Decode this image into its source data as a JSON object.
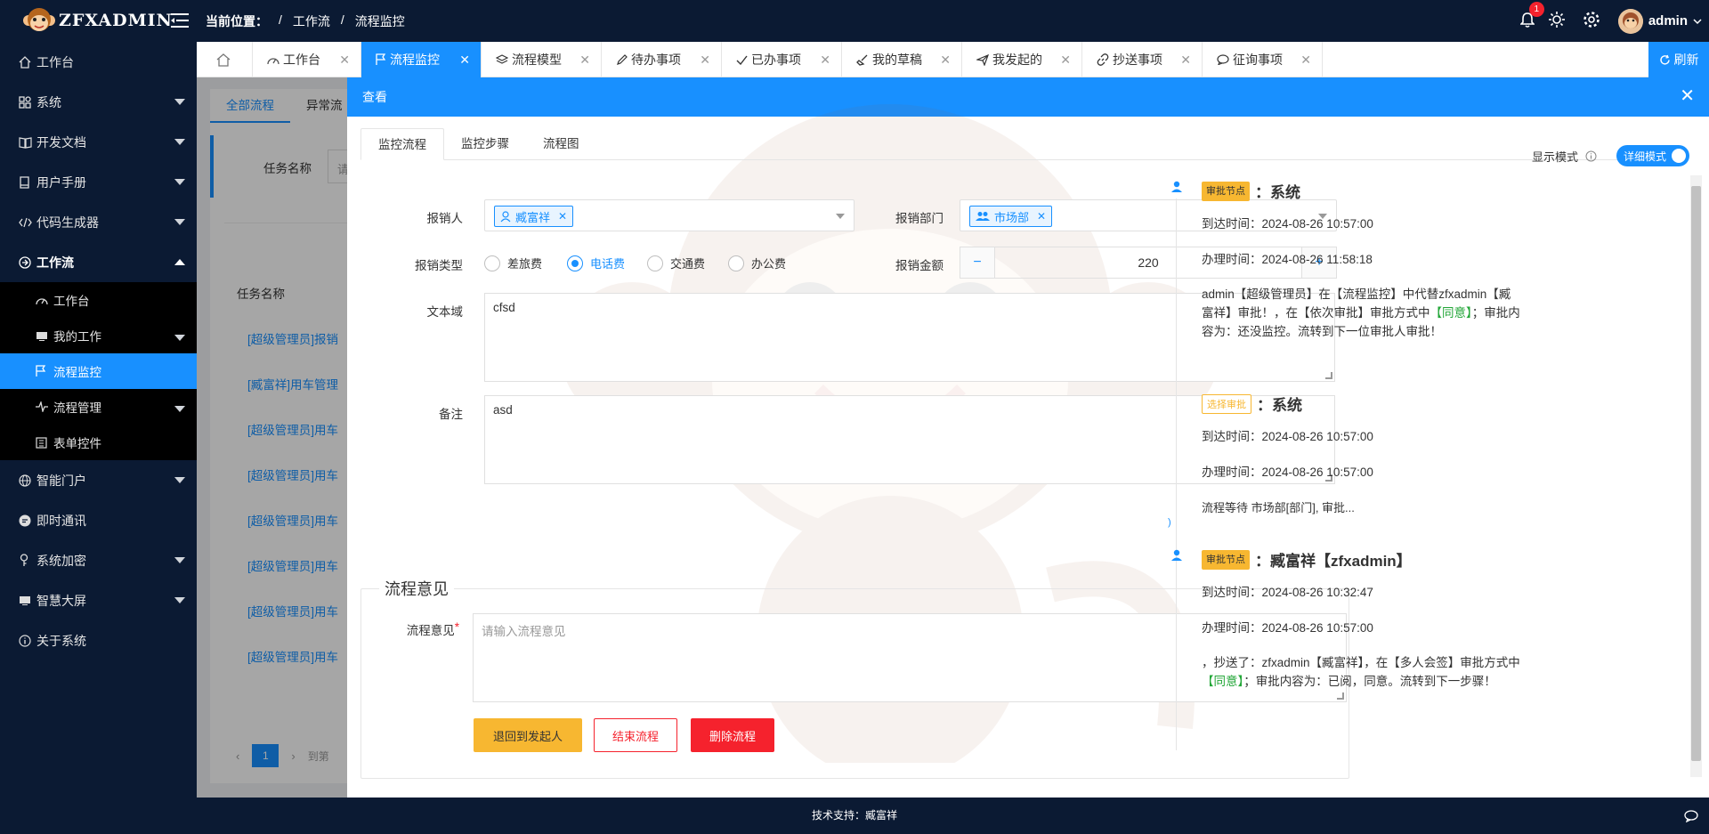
{
  "app": {
    "logo_text": "ZFXADMIN",
    "brand_color": "#1890ff",
    "dark_color": "#0b1a33"
  },
  "header": {
    "crumb_label": "当前位置：",
    "crumb_sep": "/",
    "crumb": [
      "工作流",
      "流程监控"
    ],
    "notification_count": "1",
    "user": "admin"
  },
  "sidebar": {
    "items": [
      {
        "label": "工作台",
        "icon": "home-icon"
      },
      {
        "label": "系统",
        "icon": "apps-icon"
      },
      {
        "label": "开发文档",
        "icon": "book-icon"
      },
      {
        "label": "用户手册",
        "icon": "manual-icon"
      },
      {
        "label": "代码生成器",
        "icon": "code-icon"
      },
      {
        "label": "工作流",
        "icon": "workflow-icon"
      }
    ],
    "sub_items": [
      {
        "label": "工作台"
      },
      {
        "label": "我的工作"
      },
      {
        "label": "流程监控"
      },
      {
        "label": "流程管理"
      },
      {
        "label": "表单控件"
      }
    ],
    "items_after": [
      {
        "label": "智能门户"
      },
      {
        "label": "即时通讯"
      },
      {
        "label": "系统加密"
      },
      {
        "label": "智慧大屏"
      },
      {
        "label": "关于系统"
      }
    ]
  },
  "tabs": [
    {
      "label": "工作台"
    },
    {
      "label": "流程监控"
    },
    {
      "label": "流程模型"
    },
    {
      "label": "待办事项"
    },
    {
      "label": "已办事项"
    },
    {
      "label": "我的草稿"
    },
    {
      "label": "我发起的"
    },
    {
      "label": "抄送事项"
    },
    {
      "label": "征询事项"
    }
  ],
  "refresh_label": "刷新",
  "background": {
    "tabs": [
      "全部流程",
      "异常流"
    ],
    "filter_label": "任务名称",
    "filter_placeholder": "请",
    "col_header": "任务名称",
    "rows": [
      "[超级管理员]报销",
      "[臧富祥]用车管理",
      "[超级管理员]用车",
      "[超级管理员]用车",
      "[超级管理员]用车",
      "[超级管理员]用车",
      "[超级管理员]用车",
      "[超级管理员]用车"
    ],
    "page": "1",
    "goto": "到第"
  },
  "modal": {
    "title": "查看",
    "tabs": [
      "监控流程",
      "监控步骤",
      "流程图"
    ],
    "form": {
      "applicant_label": "报销人",
      "applicant_value": "臧富祥",
      "dept_label": "报销部门",
      "dept_value": "市场部",
      "type_label": "报销类型",
      "type_options": [
        "差旅费",
        "电话费",
        "交通费",
        "办公费"
      ],
      "type_selected": "电话费",
      "amount_label": "报销金额",
      "amount_value": "220",
      "amount_minus": "−",
      "amount_plus": "+",
      "textarea_label": "文本域",
      "textarea_value": "cfsd",
      "remark_label": "备注",
      "remark_value": "asd"
    },
    "opinion": {
      "legend": "流程意见",
      "label": "流程意见",
      "required": "*",
      "placeholder": "请输入流程意见",
      "buttons": {
        "back": "退回到发起人",
        "end": "结束流程",
        "delete": "删除流程"
      }
    },
    "display_mode_label": "显示模式",
    "display_mode_value": "详细模式",
    "timeline": [
      {
        "tag": "审批节点",
        "title": "：系统",
        "arrive": "到达时间：2024-08-26 10:57:00",
        "handle": "办理时间：2024-08-26 11:58:18",
        "desc": "admin【超级管理员】在【流程监控】中代替zfxadmin【臧富祥】审批！，在【依次审批】审批方式中",
        "agree": "【同意】",
        "desc2": "；审批内容为：还没监控。流转到下一位审批人审批！"
      },
      {
        "tag": "选择审批",
        "title": "：系统",
        "arrive": "到达时间：2024-08-26 10:57:00",
        "handle": "办理时间：2024-08-26 10:57:00",
        "desc": "流程等待 市场部[部门], 审批..."
      },
      {
        "tag": "审批节点",
        "title": "：臧富祥【zfxadmin】",
        "arrive": "到达时间：2024-08-26 10:32:47",
        "handle": "办理时间：2024-08-26 10:57:00",
        "desc": "，抄送了：zfxadmin【臧富祥】，在【多人会签】审批方式中",
        "agree": "【同意】",
        "desc2": "；审批内容为：已阅，同意。流转到下一步骤！"
      }
    ]
  },
  "footer": "技术支持：臧富祥"
}
